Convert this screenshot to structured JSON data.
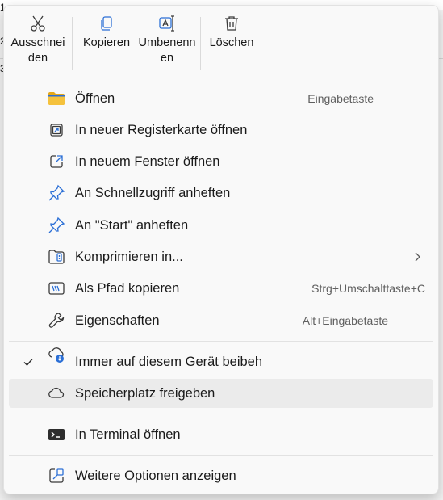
{
  "background": {
    "glyph_top": "1",
    "glyph_mid": "2",
    "glyph_low": "3"
  },
  "actions": [
    {
      "id": "cut",
      "label": "Ausschnei\nden",
      "icon": "scissors-icon"
    },
    {
      "id": "copy",
      "label": "Kopieren",
      "icon": "copy-icon"
    },
    {
      "id": "rename",
      "label": "Umbenenn\nen",
      "icon": "rename-icon"
    },
    {
      "id": "delete",
      "label": "Löschen",
      "icon": "trash-icon"
    }
  ],
  "items": [
    {
      "label": "Öffnen",
      "shortcut": "Eingabetaste",
      "icon": "folder-icon"
    },
    {
      "label": "In neuer Registerkarte öffnen",
      "shortcut": "",
      "icon": "new-tab-icon"
    },
    {
      "label": "In neuem Fenster öffnen",
      "shortcut": "",
      "icon": "open-external-icon"
    },
    {
      "label": "An Schnellzugriff anheften",
      "shortcut": "",
      "icon": "pin-icon"
    },
    {
      "label": "An \"Start\" anheften",
      "shortcut": "",
      "icon": "pin-icon"
    },
    {
      "label": "Komprimieren in...",
      "shortcut": "",
      "icon": "zip-folder-icon",
      "submenu": true
    },
    {
      "label": "Als Pfad kopieren",
      "shortcut": "Strg+Umschalttaste+C",
      "icon": "copy-path-icon"
    },
    {
      "label": "Eigenschaften",
      "shortcut": "Alt+Eingabetaste",
      "icon": "wrench-icon"
    },
    {
      "label": "Immer auf diesem Gerät beibeh",
      "shortcut": "",
      "icon": "cloud-download-icon",
      "checked": true
    },
    {
      "label": "Speicherplatz freigeben",
      "shortcut": "",
      "icon": "cloud-icon",
      "hovered": true
    },
    {
      "label": "In Terminal öffnen",
      "shortcut": "",
      "icon": "terminal-icon"
    },
    {
      "label": "Weitere Optionen anzeigen",
      "shortcut": "",
      "icon": "more-options-icon"
    }
  ],
  "colors": {
    "accent_blue": "#2b6fd6",
    "folder_yellow": "#f5c23d",
    "menu_bg": "#f9f9f9",
    "hover_bg": "#ebebeb"
  }
}
